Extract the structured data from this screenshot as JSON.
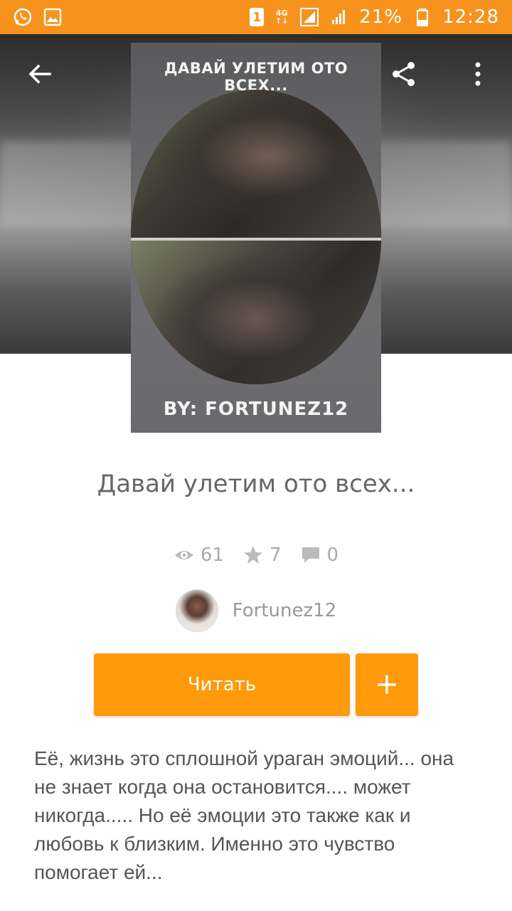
{
  "status_bar": {
    "sim_badge": "1",
    "network_top": "4G",
    "network_bottom": "↑↓",
    "battery_percent": "21%",
    "time": "12:28",
    "icons": [
      "whatsapp-icon",
      "image-icon",
      "sim-icon",
      "4g-icon",
      "signal-icon",
      "signal-icon",
      "battery-icon"
    ]
  },
  "toolbar": {
    "icons": [
      "back-arrow-icon",
      "share-icon",
      "more-vertical-icon"
    ]
  },
  "cover": {
    "title_text": "ДАВАЙ УЛЕТИМ ОТО ВСЕХ...",
    "author_text": "BY: FORTUNEZ12"
  },
  "story": {
    "title": "Давай улетим ото всех...",
    "views": "61",
    "votes": "7",
    "comments": "0",
    "stat_icons": [
      "eye-icon",
      "star-icon",
      "comment-icon"
    ]
  },
  "author": {
    "name": "Fortunez12"
  },
  "actions": {
    "read_label": "Читать",
    "add_icon": "plus-icon",
    "accent": "#ff9a0a"
  },
  "description": "Её, жизнь это сплошной ураган эмоций... она не знает когда она остановится.... может никогда..... Но её эмоции это также как и любовь к близким. Именно это чувство помогает ей...",
  "colors": {
    "status_bar": "#f7931d",
    "text_muted": "#999999"
  }
}
